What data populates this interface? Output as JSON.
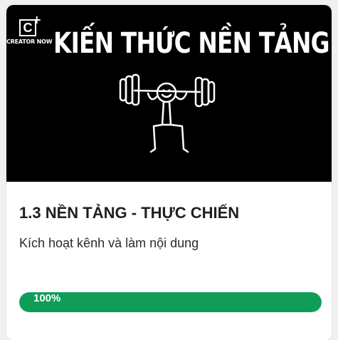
{
  "card": {
    "brand": {
      "symbol": "C",
      "plus": "+",
      "text": "CREATOR NOW"
    },
    "thumbnail_title": "KIẾN THỨC NỀN TẢNG",
    "thumbnail_icon": "weightlifter-stick-figure",
    "title": "1.3 NỀN TẢNG - THỰC CHIẾN",
    "subtitle": "Kích hoạt kênh và làm nội dung",
    "progress": {
      "value": 100,
      "label": "100%",
      "color": "#0f9d58"
    }
  }
}
